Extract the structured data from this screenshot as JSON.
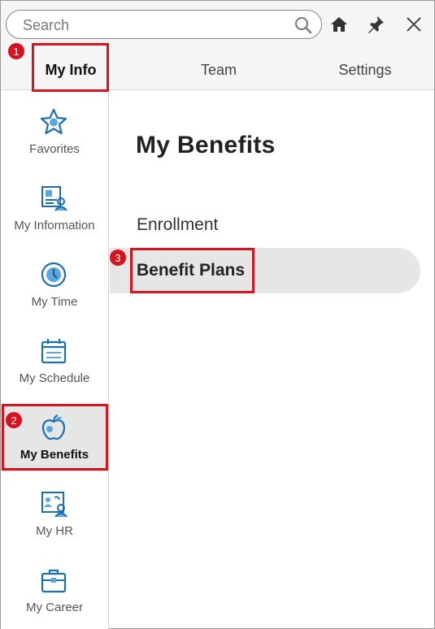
{
  "search": {
    "placeholder": "Search"
  },
  "header_icons": [
    "search-icon",
    "home-icon",
    "pin-icon",
    "close-icon"
  ],
  "tabs": [
    {
      "label": "My Info",
      "active": true
    },
    {
      "label": "Team",
      "active": false
    },
    {
      "label": "Settings",
      "active": false
    }
  ],
  "sidebar": {
    "items": [
      {
        "label": "Favorites",
        "icon": "star-icon"
      },
      {
        "label": "My Information",
        "icon": "id-card-icon"
      },
      {
        "label": "My Time",
        "icon": "clock-icon"
      },
      {
        "label": "My Schedule",
        "icon": "calendar-icon"
      },
      {
        "label": "My Benefits",
        "icon": "apple-icon",
        "active": true
      },
      {
        "label": "My HR",
        "icon": "hr-people-icon"
      },
      {
        "label": "My Career",
        "icon": "briefcase-icon"
      }
    ]
  },
  "main": {
    "title": "My Benefits",
    "items": [
      {
        "label": "Enrollment"
      },
      {
        "label": "Benefit Plans",
        "active": true
      }
    ]
  },
  "annotations": {
    "step1": "1",
    "step2": "2",
    "step3": "3"
  },
  "colors": {
    "accent_blue": "#1a6fb5",
    "highlight_red": "#d8121f",
    "active_bg": "#e6e6e6"
  }
}
